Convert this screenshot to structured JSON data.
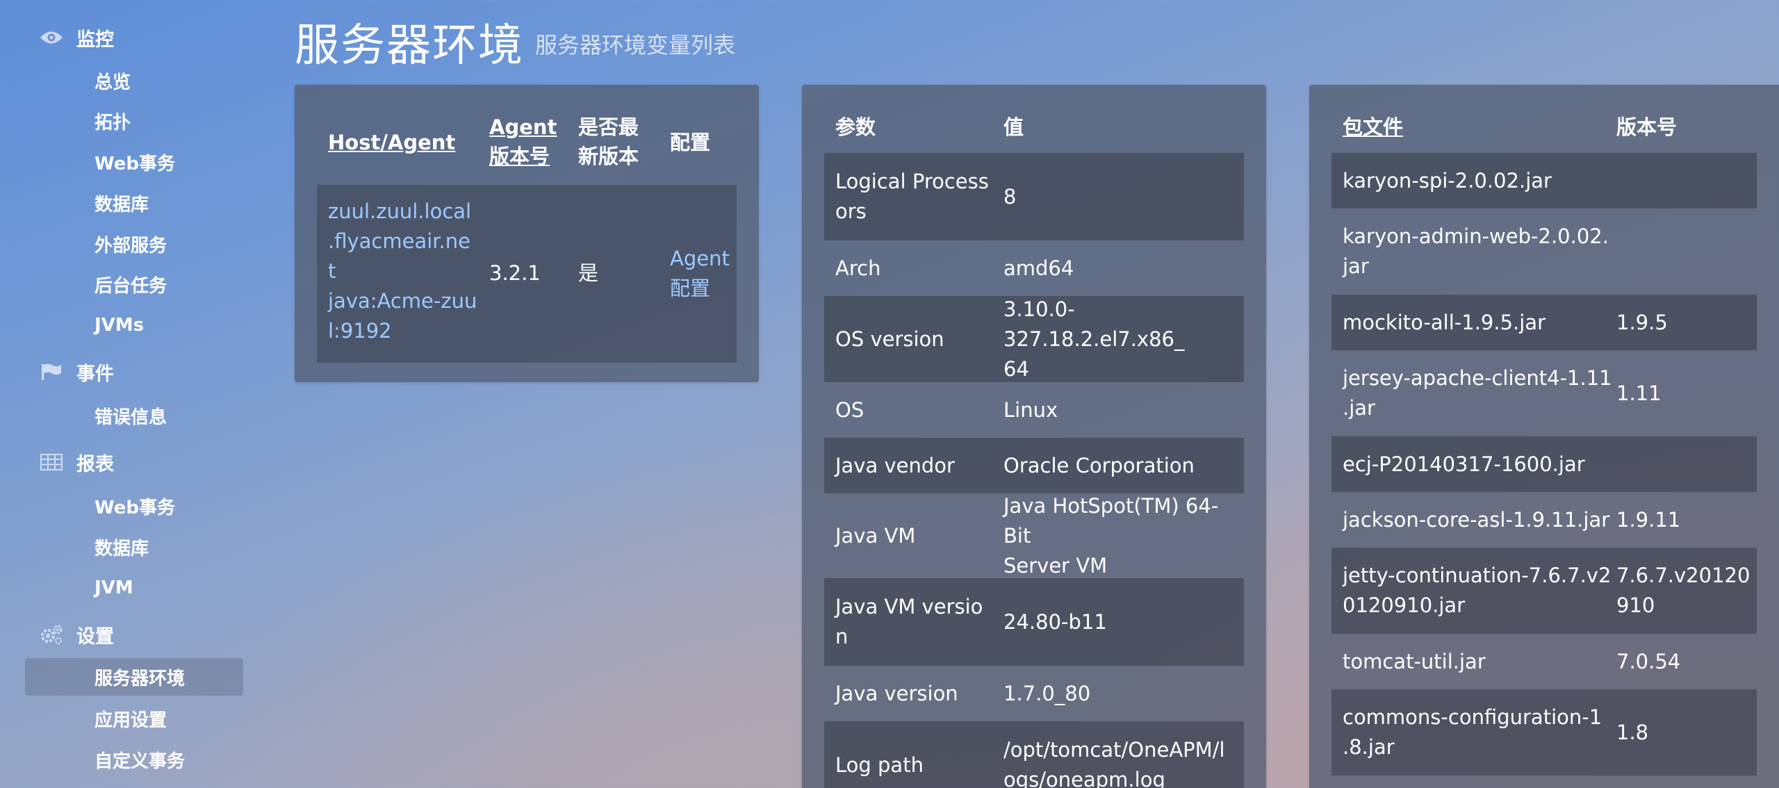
{
  "sidebar": {
    "monitor": {
      "label": "监控",
      "items": [
        "总览",
        "拓扑",
        "Web事务",
        "数据库",
        "外部服务",
        "后台任务",
        "JVMs"
      ]
    },
    "events": {
      "label": "事件",
      "items": [
        "错误信息"
      ]
    },
    "reports": {
      "label": "报表",
      "items": [
        "Web事务",
        "数据库",
        "JVM"
      ]
    },
    "settings": {
      "label": "设置",
      "items": [
        "服务器环境",
        "应用设置",
        "自定义事务"
      ]
    }
  },
  "page": {
    "title": "服务器环境",
    "subtitle": "服务器环境变量列表"
  },
  "host_table": {
    "headers": {
      "host": "Host/Agent",
      "agent_version": "Agent\n版本号",
      "latest": "是否最\n新版本",
      "config": "配置"
    },
    "row": {
      "host": "zuul.zuul.local\n.flyacmeair.ne\nt\njava:Acme-zuu\nl:9192",
      "agent_version": "3.2.1",
      "latest": "是",
      "config": "Agent\n配置"
    }
  },
  "params_table": {
    "headers": {
      "param": "参数",
      "value": "值"
    },
    "rows": [
      {
        "param": "Logical Process\nors",
        "value": "8"
      },
      {
        "param": "Arch",
        "value": "amd64"
      },
      {
        "param": "OS version",
        "value": "3.10.0-327.18.2.el7.x86_\n64"
      },
      {
        "param": "OS",
        "value": "Linux"
      },
      {
        "param": "Java vendor",
        "value": "Oracle Corporation"
      },
      {
        "param": "Java VM",
        "value": "Java HotSpot(TM) 64-Bit\nServer VM"
      },
      {
        "param": "Java VM versio\nn",
        "value": "24.80-b11"
      },
      {
        "param": "Java version",
        "value": "1.7.0_80"
      },
      {
        "param": "Log path",
        "value": "/opt/tomcat/OneAPM/l\nogs/oneapm.log"
      }
    ]
  },
  "packages_table": {
    "headers": {
      "file": "包文件",
      "version": "版本号"
    },
    "rows": [
      {
        "file": "karyon-spi-2.0.02.jar",
        "version": ""
      },
      {
        "file": "karyon-admin-web-2.0.02.\njar",
        "version": ""
      },
      {
        "file": "mockito-all-1.9.5.jar",
        "version": "1.9.5"
      },
      {
        "file": "jersey-apache-client4-1.11\n.jar",
        "version": "1.11"
      },
      {
        "file": "ecj-P20140317-1600.jar",
        "version": ""
      },
      {
        "file": "jackson-core-asl-1.9.11.jar",
        "version": "1.9.11"
      },
      {
        "file": "jetty-continuation-7.6.7.v2\n0120910.jar",
        "version": "7.6.7.v20120\n910"
      },
      {
        "file": "tomcat-util.jar",
        "version": "7.0.54"
      },
      {
        "file": "commons-configuration-1\n.8.jar",
        "version": "1.8"
      }
    ]
  }
}
